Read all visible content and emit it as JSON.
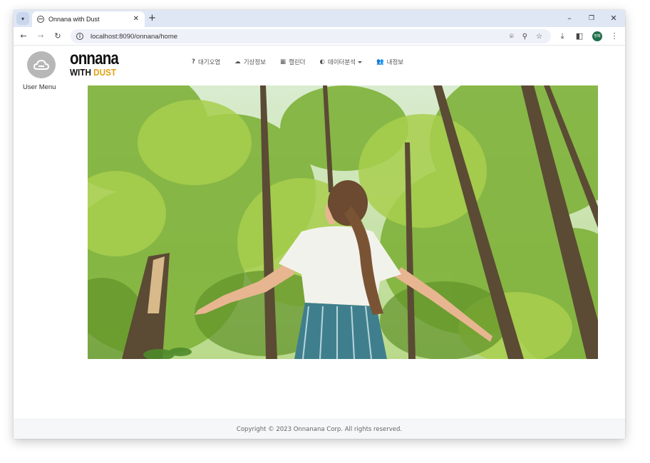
{
  "browser": {
    "tab_title": "Onnana with Dust",
    "url": "localhost:8090/onnana/home",
    "new_tab_label": "+",
    "minimize_label": "–",
    "restore_label": "❐",
    "close_label": "✕",
    "profile_label": "방패"
  },
  "page": {
    "user_menu_label": "User Menu",
    "logo": {
      "top": "onnana",
      "with": "WITH ",
      "dust": "DUST"
    },
    "nav": [
      {
        "icon": "question-icon",
        "label": "대기오염"
      },
      {
        "icon": "cloud-sun-icon",
        "label": "기상정보"
      },
      {
        "icon": "calendar-icon",
        "label": "캘린더"
      },
      {
        "icon": "brain-icon",
        "label": "데이터분석"
      },
      {
        "icon": "users-icon",
        "label": "내정보"
      }
    ],
    "hero_image": "woman-in-forest-photo",
    "footer": "Copyright © 2023 Onnanana Corp. All rights reserved."
  },
  "colors": {
    "accent_dust": "#e2a118",
    "tab_bar": "#dfe7f5",
    "avatar_gray": "#b7b7b7"
  }
}
